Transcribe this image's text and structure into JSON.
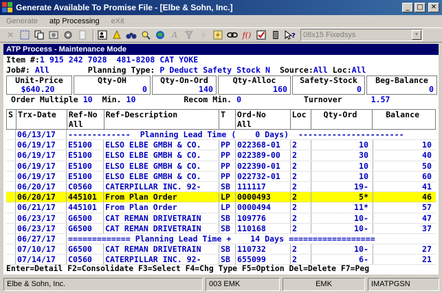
{
  "window": {
    "title": "Generate Available To Promise File - [Elbe & Sohn, Inc.]",
    "buttons": {
      "minimize": "_",
      "maximize": "□",
      "close": "✕"
    }
  },
  "menu": [
    {
      "label": "Generate",
      "enabled": false
    },
    {
      "label": "atp Processing",
      "enabled": true
    },
    {
      "label": "eXit",
      "enabled": false
    }
  ],
  "toolbar": {
    "icons": [
      "close-x-icon",
      "select-box-icon",
      "copy-icon",
      "settings-icon",
      "gear-icon",
      "page-icon",
      "user-icon",
      "bell-icon",
      "binoculars-icon",
      "find-icon",
      "globe-icon",
      "italic-a-icon",
      "filter-icon",
      "lightning-icon",
      "lightning2-icon",
      "link-icon",
      "function-icon",
      "checkbox-icon",
      "stack-icon",
      "help-icon"
    ],
    "font_combo": "08x15 Fixedsys"
  },
  "terminal": {
    "header": "ATP Process - Maintenance Mode",
    "item_label": "Item #:",
    "item_value": "1 915 242 7028  481-8208 CAT YOKE",
    "job_label": "Job#:",
    "job_value": "All",
    "planning_label": "Planning Type:",
    "planning_value": "P Deduct Safety Stock",
    "planning_flag": "N",
    "source_label": "Source:",
    "source_value": "All",
    "loc_label": "Loc:",
    "loc_value": "All",
    "boxes": [
      {
        "header": "Unit-Price",
        "value": "$640.20"
      },
      {
        "header": "Qty-OH",
        "value": "0"
      },
      {
        "header": "Qty-On-Ord",
        "value": "140"
      },
      {
        "header": "Qty-Alloc",
        "value": "160"
      },
      {
        "header": "Safety-Stock",
        "value": "0"
      },
      {
        "header": "Beg-Balance",
        "value": "0"
      }
    ],
    "order_multiple_label": "Order Multiple",
    "order_multiple_value": "10",
    "min_label": "Min.",
    "min_value": "10",
    "recom_label": "Recom Min.",
    "recom_value": "0",
    "turnover_label": "Turnover",
    "turnover_value": "1.57",
    "columns": [
      "S",
      "Trx-Date",
      "Ref-No\nAll",
      "Ref-Description",
      "T",
      "Ord-No\nAll",
      "Loc",
      "Qty-Ord",
      "Balance"
    ],
    "rows": [
      {
        "type": "band",
        "date": "06/13/17",
        "text": "-------------  Planning Lead Time (    0 Days)  ----------------------"
      },
      {
        "type": "row",
        "s": "",
        "date": "06/19/17",
        "ref": "E5100",
        "desc": "ELSO ELBE GMBH & CO.",
        "t": "PP",
        "ord": "022368-01",
        "loc": "2",
        "qty": "10",
        "bal": "10"
      },
      {
        "type": "row",
        "s": "",
        "date": "06/19/17",
        "ref": "E5100",
        "desc": "ELSO ELBE GMBH & CO.",
        "t": "PP",
        "ord": "022389-00",
        "loc": "2",
        "qty": "30",
        "bal": "40"
      },
      {
        "type": "row",
        "s": "",
        "date": "06/19/17",
        "ref": "E5100",
        "desc": "ELSO ELBE GMBH & CO.",
        "t": "PP",
        "ord": "022390-01",
        "loc": "2",
        "qty": "10",
        "bal": "50"
      },
      {
        "type": "row",
        "s": "",
        "date": "06/19/17",
        "ref": "E5100",
        "desc": "ELSO ELBE GMBH & CO.",
        "t": "PP",
        "ord": "022732-01",
        "loc": "2",
        "qty": "10",
        "bal": "60"
      },
      {
        "type": "row",
        "s": "",
        "date": "06/20/17",
        "ref": "C0560",
        "desc": "CATERPILLAR INC. 92-",
        "t": "SB",
        "ord": "111117",
        "loc": "2",
        "qty": "19-",
        "bal": "41"
      },
      {
        "type": "row",
        "s": "",
        "date": "06/20/17",
        "ref": "445101",
        "desc": "From Plan Order",
        "t": "LP",
        "ord": "0000493",
        "loc": "2",
        "qty": "5*",
        "bal": "46",
        "highlight": true
      },
      {
        "type": "row",
        "s": "",
        "date": "06/21/17",
        "ref": "445101",
        "desc": "From Plan Order",
        "t": "LP",
        "ord": "0000494",
        "loc": "2",
        "qty": "11*",
        "bal": "57"
      },
      {
        "type": "row",
        "s": "",
        "date": "06/23/17",
        "ref": "G6500",
        "desc": "CAT REMAN DRIVETRAIN",
        "t": "SB",
        "ord": "109776",
        "loc": "2",
        "qty": "10-",
        "bal": "47"
      },
      {
        "type": "row",
        "s": "",
        "date": "06/23/17",
        "ref": "G6500",
        "desc": "CAT REMAN DRIVETRAIN",
        "t": "SB",
        "ord": "110168",
        "loc": "2",
        "qty": "10-",
        "bal": "37"
      },
      {
        "type": "band",
        "date": "06/27/17",
        "text": "============= Planning Lead Time +    14 Days =================="
      },
      {
        "type": "row",
        "s": "",
        "date": "07/10/17",
        "ref": "G6500",
        "desc": "CAT REMAN DRIVETRAIN",
        "t": "SB",
        "ord": "110732",
        "loc": "2",
        "qty": "10-",
        "bal": "27"
      },
      {
        "type": "row",
        "s": "",
        "date": "07/14/17",
        "ref": "C0560",
        "desc": "CATERPILLAR INC. 92-",
        "t": "SB",
        "ord": "655099",
        "loc": "2",
        "qty": "6-",
        "bal": "21"
      }
    ],
    "fkeys": "Enter=Detail F2=Consolidate F3=Select F4=Chg Type F5=Option Del=Delete F7=Peg"
  },
  "status": {
    "company": "Elbe & Sohn, Inc.",
    "user": "003 EMK",
    "user2": "EMK",
    "program": "IMATPGSN"
  },
  "colors": {
    "title_start": "#0a246a",
    "title_end": "#3a6ea5",
    "terminal_text": "#0000b8",
    "highlight": "#ffff00",
    "header_band": "#00006b"
  }
}
